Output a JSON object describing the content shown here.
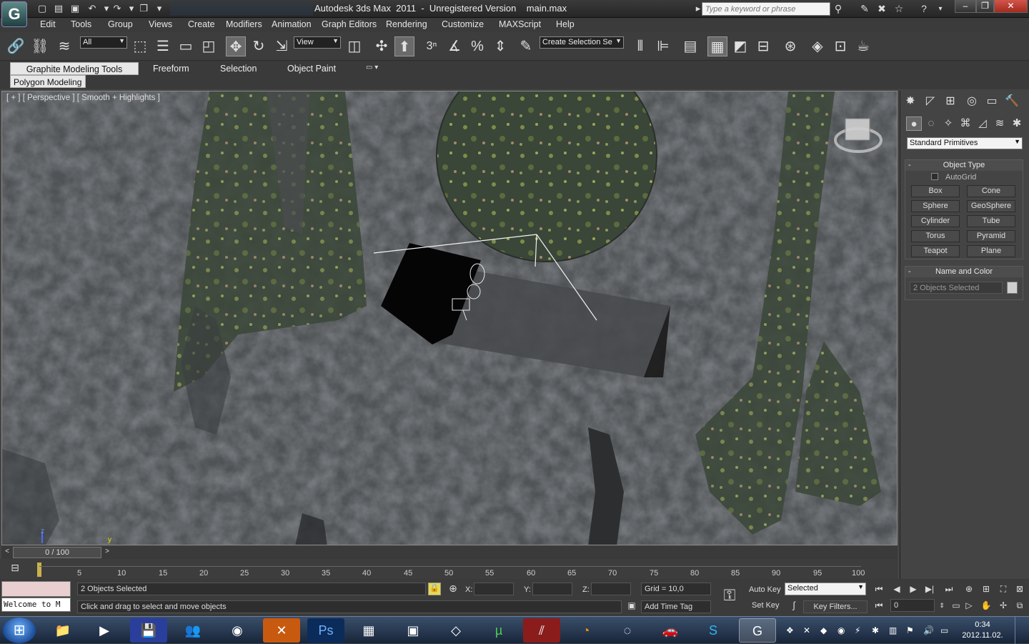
{
  "title_bar": {
    "title": "Autodesk 3ds Max  2011  -  Unregistered Version    main.max",
    "search_placeholder": "Type a keyword or phrase",
    "logo_glyph": "G"
  },
  "menu": [
    "Edit",
    "Tools",
    "Group",
    "Views",
    "Create",
    "Modifiers",
    "Animation",
    "Graph Editors",
    "Rendering",
    "Customize",
    "MAXScript",
    "Help"
  ],
  "toolbar": {
    "selection_filter": "All",
    "ref_coord": "View",
    "named_selection": "Create Selection Se",
    "snap_label": "3"
  },
  "ribbon": {
    "tabs": [
      "Graphite Modeling Tools",
      "Freeform",
      "Selection",
      "Object Paint"
    ],
    "active_sub": "Polygon Modeling"
  },
  "viewport": {
    "label": "[ + ] [ Perspective ] [ Smooth + Highlights ]",
    "axis_z": "z",
    "axis_y": "y"
  },
  "command_panel": {
    "category": "Standard Primitives",
    "object_type_title": "Object Type",
    "autogrid": "AutoGrid",
    "primitives": [
      "Box",
      "Cone",
      "Sphere",
      "GeoSphere",
      "Cylinder",
      "Tube",
      "Torus",
      "Pyramid",
      "Teapot",
      "Plane"
    ],
    "name_color_title": "Name and Color",
    "name_value": "2 Objects Selected",
    "collapse_glyph": "-"
  },
  "time": {
    "slider": "0 / 100",
    "ticks": [
      "5",
      "10",
      "15",
      "20",
      "25",
      "30",
      "35",
      "40",
      "45",
      "50",
      "55",
      "60",
      "65",
      "70",
      "75",
      "80",
      "85",
      "90",
      "95",
      "100"
    ]
  },
  "status": {
    "listener": "Welcome to M",
    "selection": "2 Objects Selected",
    "prompt": "Click and drag to select and move objects",
    "x_label": "X:",
    "y_label": "Y:",
    "z_label": "Z:",
    "grid": "Grid = 10,0",
    "add_time_tag": "Add Time Tag",
    "auto_key": "Auto Key",
    "set_key": "Set Key",
    "key_mode": "Selected",
    "key_filters": "Key Filters...",
    "frame": "0"
  },
  "taskbar": {
    "clock_time": "0:34",
    "clock_date": "2012.11.02."
  }
}
